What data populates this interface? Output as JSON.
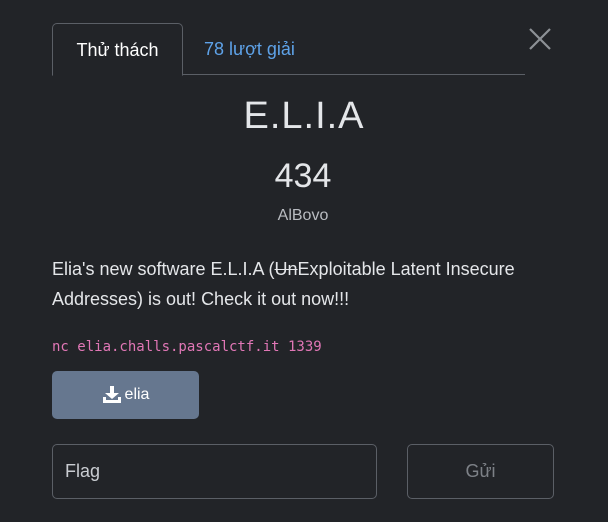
{
  "tabs": {
    "challenge_label": "Thử thách",
    "solves_label": "78 lượt giải"
  },
  "challenge": {
    "name": "E.L.I.A",
    "points": "434",
    "author": "AlBovo",
    "description_before": "Elia's new software E.L.I.A (",
    "description_strike": "Un",
    "description_after": "Exploitable Latent Insecure Addresses) is out! Check it out now!!!",
    "connection": "nc elia.challs.pascalctf.it 1339"
  },
  "download": {
    "label": "elia"
  },
  "form": {
    "flag_placeholder": "Flag",
    "submit_label": "Gửi"
  },
  "colors": {
    "background": "#222428",
    "link": "#5ea2e8",
    "code": "#e177b6",
    "download_button": "#66778f"
  },
  "icons": {
    "close": "close-icon",
    "download": "download-icon"
  }
}
